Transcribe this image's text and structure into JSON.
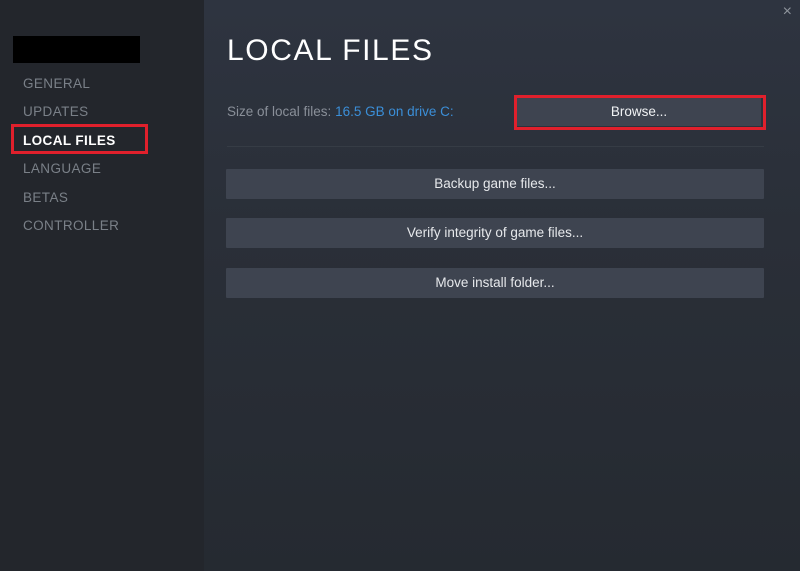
{
  "window": {
    "close_glyph": "×"
  },
  "sidebar": {
    "items": [
      {
        "label": "GENERAL"
      },
      {
        "label": "UPDATES"
      },
      {
        "label": "LOCAL FILES",
        "active": true
      },
      {
        "label": "LANGUAGE"
      },
      {
        "label": "BETAS"
      },
      {
        "label": "CONTROLLER"
      }
    ]
  },
  "main": {
    "title": "LOCAL FILES",
    "size_label": "Size of local files:",
    "size_value": "16.5 GB on drive C:",
    "browse_label": "Browse...",
    "buttons": [
      {
        "label": "Backup game files..."
      },
      {
        "label": "Verify integrity of game files..."
      },
      {
        "label": "Move install folder..."
      }
    ]
  },
  "colors": {
    "highlight": "#e0202c",
    "link": "#3b8fd8",
    "button": "#3e4450"
  }
}
